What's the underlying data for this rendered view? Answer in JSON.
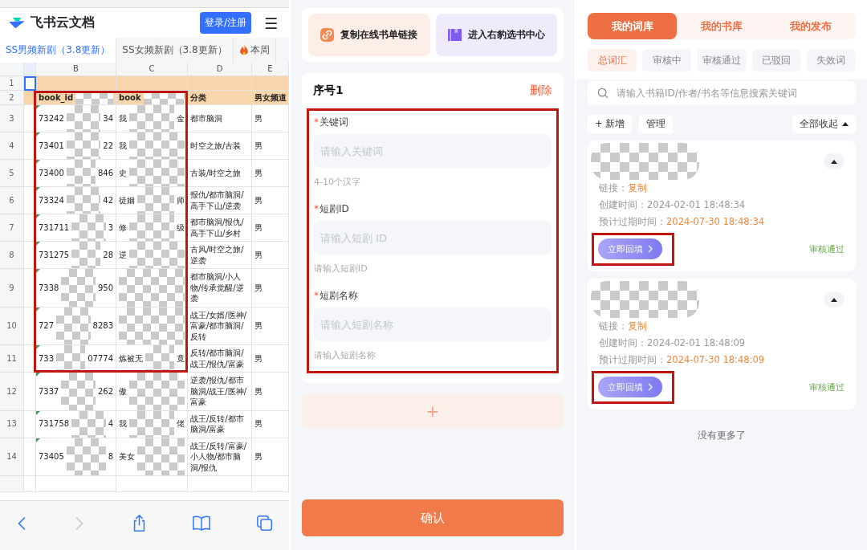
{
  "feishu": {
    "brand": "飞书云文档",
    "login_button": "登录/注册",
    "menu_icon": "☰",
    "sheet_tabs": [
      {
        "label": "SS男频新剧（3.8更新）",
        "selected": true,
        "kind": "plain"
      },
      {
        "label": "SS女频新剧（3.8更新）",
        "selected": false,
        "kind": "plain"
      },
      {
        "label": "本周",
        "selected": false,
        "kind": "hot"
      }
    ],
    "columns": [
      "B",
      "C",
      "D",
      "E"
    ],
    "first_row": "1",
    "header_row": {
      "num": "2",
      "cells": [
        "book_id",
        "book",
        "分类",
        "男女频道"
      ]
    },
    "rows": [
      {
        "num": "3",
        "b_start": "73242",
        "b_end": "34",
        "c_start": "我",
        "c_end": "金",
        "d": "都市脑洞",
        "e": "男"
      },
      {
        "num": "4",
        "b_start": "73401",
        "b_end": "22",
        "c_start": "我",
        "c_end": "",
        "d": "时空之旅/古装",
        "e": "男"
      },
      {
        "num": "5",
        "b_start": "73400",
        "b_end": "846",
        "c_start": "史",
        "c_end": "",
        "d": "古装/时空之旅",
        "e": "男"
      },
      {
        "num": "6",
        "b_start": "73324",
        "b_end": "42",
        "c_start": "徒姻",
        "c_end": "师",
        "d": "报仇/都市脑洞/高手下山/逆袭",
        "e": "男"
      },
      {
        "num": "7",
        "b_start": "731711",
        "b_end": "3",
        "c_start": "修",
        "c_end": "级",
        "d": "都市脑洞/报仇/高手下山/乡村",
        "e": "男"
      },
      {
        "num": "8",
        "b_start": "731275",
        "b_end": "28",
        "c_start": "逆",
        "c_end": "",
        "d": "古风/时空之旅/逆袭",
        "e": "男"
      },
      {
        "num": "9",
        "b_start": "7338",
        "b_end": "950",
        "c_start": "",
        "c_end": "",
        "d": "都市脑洞/小人物/传承觉醒/逆袭",
        "e": "男"
      },
      {
        "num": "10",
        "b_start": "727",
        "b_end": "8283",
        "c_start": "",
        "c_end": "",
        "d": "战王/女婿/医神/富豪/都市脑洞/反转",
        "e": "男"
      },
      {
        "num": "11",
        "b_start": "733",
        "b_end": "07774",
        "c_start": "炼被无",
        "c_end": "竟",
        "d": "反转/都市脑洞/战王/报仇/富豪",
        "e": "男"
      },
      {
        "num": "12",
        "b_start": "7337",
        "b_end": "262",
        "c_start": "傲",
        "c_end": "",
        "d": "逆袭/报仇/都市脑洞/战王/医神/富豪",
        "e": "男"
      },
      {
        "num": "13",
        "b_start": "731758",
        "b_end": "4",
        "c_start": "我",
        "c_end": "佬",
        "d": "战王/反转/都市脑洞/富豪",
        "e": "男"
      },
      {
        "num": "14",
        "b_start": "73405",
        "b_end": "8",
        "c_start": "美女",
        "c_end": "",
        "d": "战王/反转/富豪/小人物/都市脑洞/报仇",
        "e": "男"
      }
    ],
    "toolbar": [
      {
        "kind": "back",
        "disabled": false
      },
      {
        "kind": "forward",
        "disabled": true
      },
      {
        "kind": "share",
        "disabled": false
      },
      {
        "kind": "bookmarks",
        "disabled": false
      },
      {
        "kind": "tabs",
        "disabled": false
      }
    ]
  },
  "form_page": {
    "actions": [
      {
        "kind": "link",
        "label": "复制在线书单链接"
      },
      {
        "kind": "book",
        "label": "进入右豹选书中心"
      }
    ],
    "title": "序号1",
    "delete": "删除",
    "fields": [
      {
        "required_mark": "*",
        "label": "关键词",
        "placeholder": "请输入关键词",
        "hint": "4-10个汉字"
      },
      {
        "required_mark": "*",
        "label": "短剧ID",
        "placeholder": "请输入短剧 ID",
        "hint": "请输入短剧ID"
      },
      {
        "required_mark": "*",
        "label": "短剧名称",
        "placeholder": "请输入短剧名称",
        "hint": "请输入短剧名称"
      }
    ],
    "add_button": "+",
    "confirm_button": "确认"
  },
  "library_page": {
    "tabs": [
      {
        "label": "我的词库",
        "selected": true
      },
      {
        "label": "我的书库",
        "selected": false
      },
      {
        "label": "我的发布",
        "selected": false
      }
    ],
    "filters": [
      {
        "label": "总词汇",
        "selected": true
      },
      {
        "label": "审核中",
        "selected": false
      },
      {
        "label": "审核通过",
        "selected": false
      },
      {
        "label": "已驳回",
        "selected": false
      },
      {
        "label": "失效词",
        "selected": false
      }
    ],
    "search": {
      "placeholder": "请输入书籍ID/作者/书名等信息搜索关键词"
    },
    "add": {
      "icon": "+",
      "label": "新增"
    },
    "manage": "管理",
    "collapse_all": "全部收起",
    "entries": [
      {
        "link_label": "链接：",
        "link_action": "复制",
        "created_label": "创建时间：",
        "created": "2024-02-01 18:48:34",
        "expires_label": "预计过期时间：",
        "expires": "2024-07-30 18:48:34",
        "fill_button": "立即回填",
        "status": "审核通过"
      },
      {
        "link_label": "链接：",
        "link_action": "复制",
        "created_label": "创建时间：",
        "created": "2024-02-01 18:48:09",
        "expires_label": "预计过期时间：",
        "expires": "2024-07-30 18:48:09",
        "fill_button": "立即回填",
        "status": "审核通过"
      }
    ],
    "end_text": "没有更多了"
  }
}
